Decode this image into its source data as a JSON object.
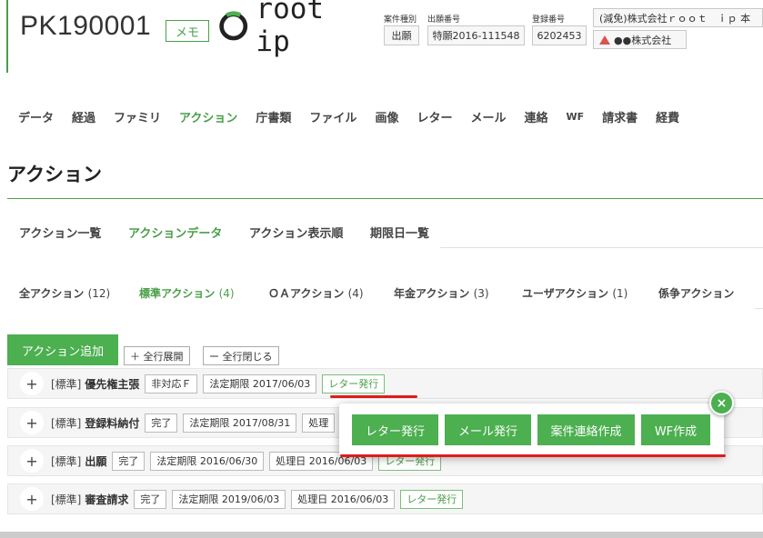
{
  "header": {
    "case_id": "PK190001",
    "memo_label": "メモ",
    "logo_text": "root ip",
    "case_type_label": "案件種別",
    "case_type_value": "出願",
    "app_no_label": "出願番号",
    "app_no_value": "特願2016-111548",
    "reg_no_label": "登録番号",
    "reg_no_value": "6202453",
    "party1": "(減免)株式会社ｒｏｏｔ　ｉｐ 本",
    "party2": "●●株式会社"
  },
  "nav": {
    "tabs": [
      "データ",
      "経過",
      "ファミリ",
      "アクション",
      "庁書類",
      "ファイル",
      "画像",
      "レター",
      "メール",
      "連絡",
      "WF",
      "請求書",
      "経費"
    ],
    "active": "アクション"
  },
  "page_title": "アクション",
  "subtabs": [
    "アクション一覧",
    "アクションデータ",
    "アクション表示順",
    "期限日一覧"
  ],
  "category_tabs": [
    {
      "label": "全アクション",
      "count": "(12)"
    },
    {
      "label": "標準アクション",
      "count": "(4)"
    },
    {
      "label": "ＯＡアクション",
      "count": "(4)"
    },
    {
      "label": "年金アクション",
      "count": "(3)"
    },
    {
      "label": "ユーザアクション",
      "count": "(1)"
    },
    {
      "label": "係争アクション",
      "count": ""
    }
  ],
  "toolbar": {
    "add_label": "アクション追加",
    "expand_label": "＋ 全行展開",
    "collapse_label": "ー 全行閉じる"
  },
  "rows": [
    {
      "tag": "[標準]",
      "name": "優先権主張",
      "status": "非対応Ｆ",
      "deadline": "法定期限 2017/06/03",
      "processed": "",
      "letter": "レター発行"
    },
    {
      "tag": "[標準]",
      "name": "登録料納付",
      "status": "完了",
      "deadline": "法定期限 2017/08/31",
      "processed": "処理",
      "letter": ""
    },
    {
      "tag": "[標準]",
      "name": "出願",
      "status": "完了",
      "deadline": "法定期限 2016/06/30",
      "processed": "処理日 2016/06/03",
      "letter": "レター発行"
    },
    {
      "tag": "[標準]",
      "name": "審査請求",
      "status": "完了",
      "deadline": "法定期限 2019/06/03",
      "processed": "処理日 2016/06/03",
      "letter": "レター発行"
    }
  ],
  "popup": {
    "buttons": [
      "レター発行",
      "メール発行",
      "案件連絡作成",
      "WF作成"
    ],
    "close_label": "×"
  },
  "colors": {
    "accent": "#4caf50",
    "highlight": "#e01c1c"
  }
}
